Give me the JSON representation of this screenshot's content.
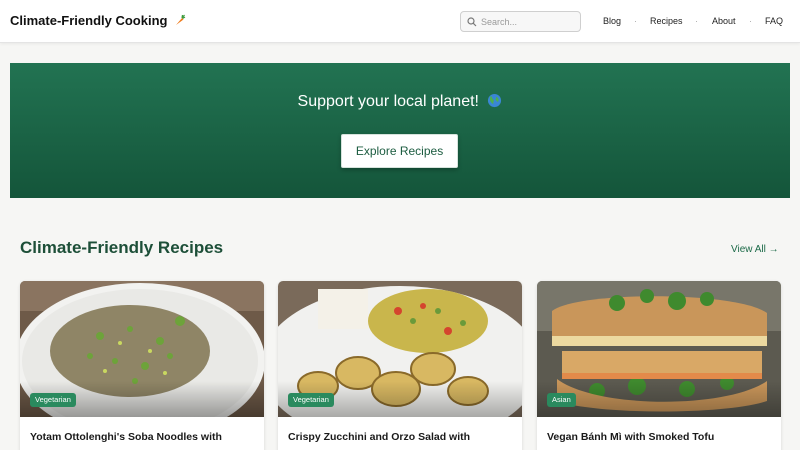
{
  "header": {
    "logo": "Climate-Friendly Cooking",
    "logo_icon": "carrot-icon",
    "search_placeholder": "Search...",
    "nav": [
      "Blog",
      "Recipes",
      "About",
      "FAQ"
    ],
    "nav_separator": "·"
  },
  "hero": {
    "title": "Support your local planet!",
    "title_icon": "globe-icon",
    "button": "Explore Recipes",
    "colors": {
      "top": "#227352",
      "bottom": "#14553a"
    }
  },
  "section": {
    "title": "Climate-Friendly Recipes",
    "view_all": "View All →"
  },
  "cards": [
    {
      "tag": "Vegetarian",
      "title": "Yotam Ottolenghi's Soba Noodles with"
    },
    {
      "tag": "Vegetarian",
      "title": "Crispy Zucchini and Orzo Salad with"
    },
    {
      "tag": "Asian",
      "title": "Vegan Bánh Mì with Smoked Tofu"
    }
  ],
  "colors": {
    "accent": "#1c6a48",
    "badge": "#2a8a5e",
    "background": "#f6f6f4"
  }
}
